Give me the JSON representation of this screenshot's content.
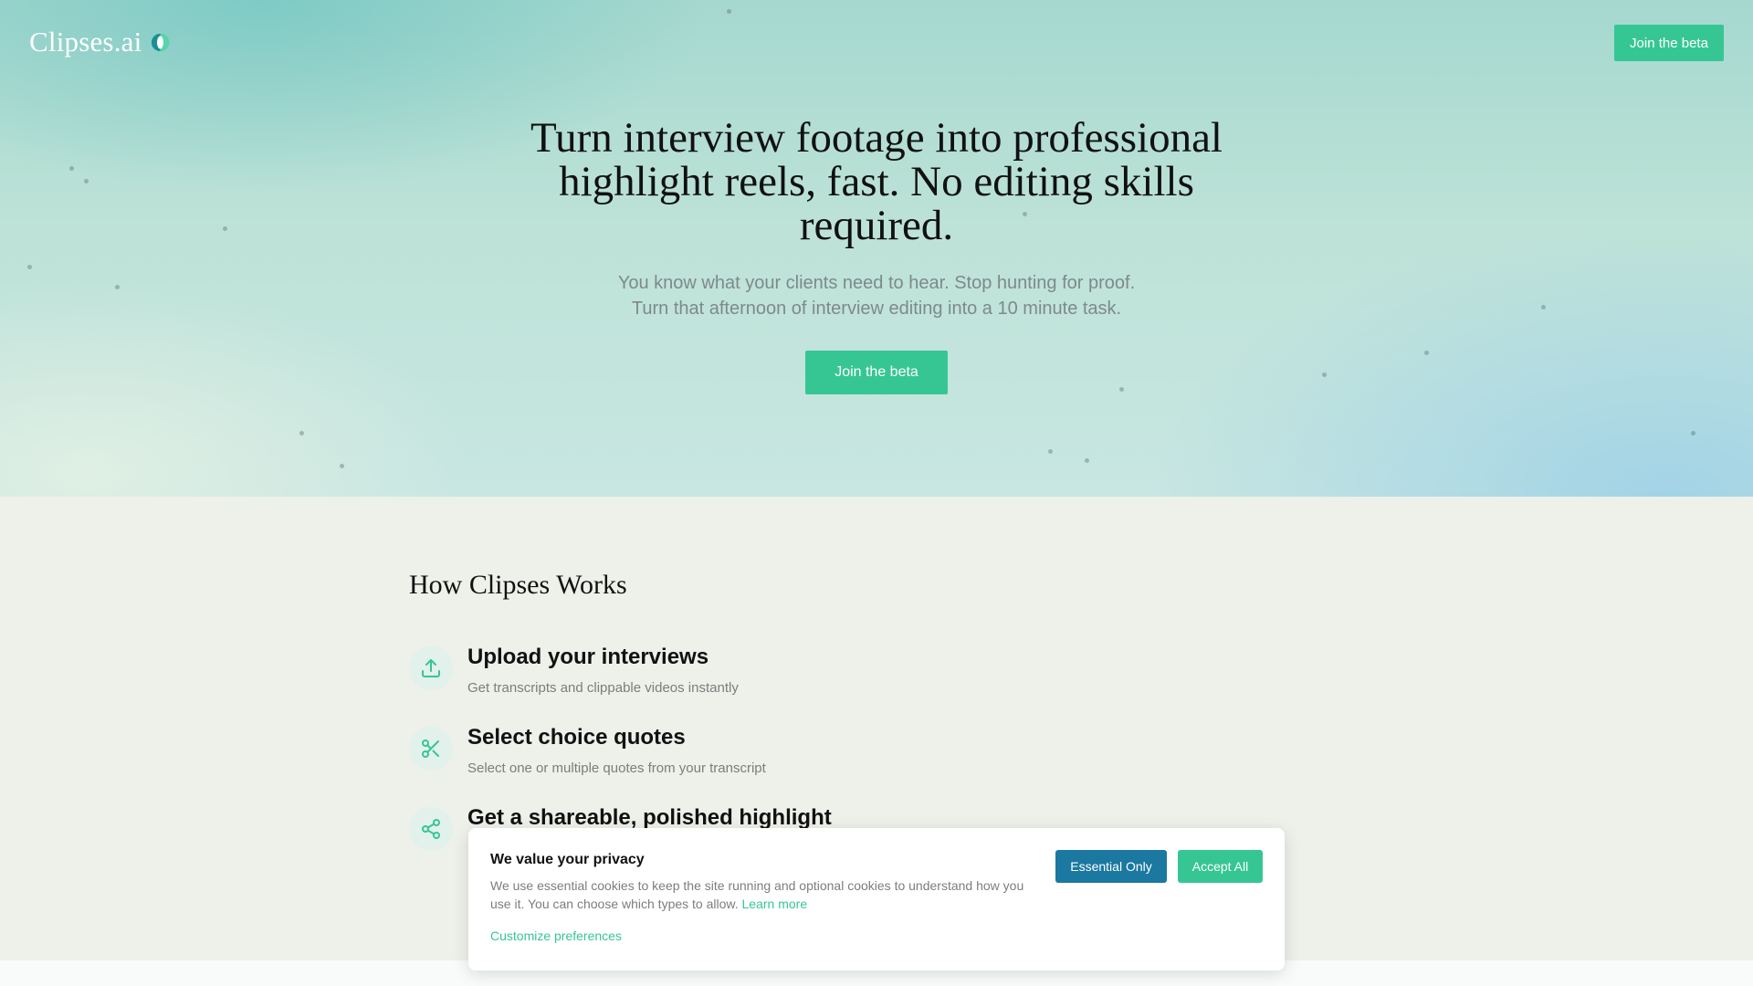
{
  "brand": {
    "name": "Clipses.ai",
    "accent": "#36c694",
    "logo_icon": "half-circle-logo-icon"
  },
  "nav": {
    "cta_label": "Join the beta"
  },
  "hero": {
    "title": "Turn interview footage into professional highlight reels, fast. No editing skills required.",
    "subtitle_line1": "You know what your clients need to hear. Stop hunting for proof.",
    "subtitle_line2": "Turn that afternoon of interview editing into a 10 minute task.",
    "cta_label": "Join the beta"
  },
  "how": {
    "title": "How Clipses Works",
    "steps": [
      {
        "icon": "upload-icon",
        "title": "Upload your interviews",
        "description": "Get transcripts and clippable videos instantly"
      },
      {
        "icon": "scissors-icon",
        "title": "Select choice quotes",
        "description": "Select one or multiple quotes from your transcript"
      },
      {
        "icon": "share-icon",
        "title": "Get a shareable, polished highlight",
        "description": ""
      }
    ]
  },
  "cookie": {
    "title": "We value your privacy",
    "text": "We use essential cookies to keep the site running and optional cookies to understand how you use it. You can choose which types to allow.",
    "learn_more": "Learn more",
    "customize": "Customize preferences",
    "essential_label": "Essential Only",
    "accept_label": "Accept All",
    "essential_color": "#1b78a0"
  }
}
